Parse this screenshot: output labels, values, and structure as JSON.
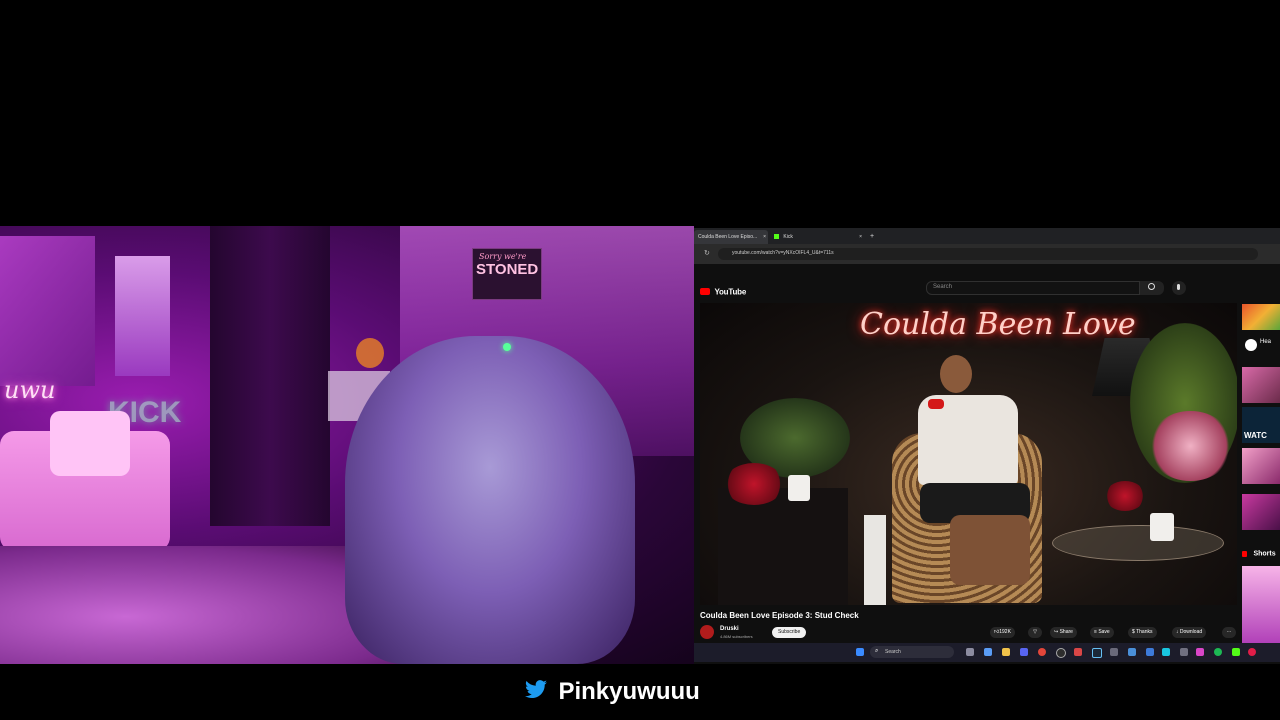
{
  "webcam": {
    "neon_sign_left": "uwu",
    "neon_sign_kick": "KICK",
    "poster_top": "STONED",
    "poster_sub": "Sorry we're",
    "neon_small": "u"
  },
  "browser": {
    "tabs": [
      {
        "label": "Coulda Been Love Episo..."
      },
      {
        "label": "Kick"
      }
    ],
    "new_tab": "+",
    "tab_close": "×",
    "url": "youtube.com/watch?v=yNXcOIFL4_U&t=711s"
  },
  "youtube": {
    "logo": "YouTube",
    "search_placeholder": "Search",
    "video_neon_title": "Coulda Been Love",
    "video_title": "Coulda Been Love Episode 3: Stud Check",
    "channel_name": "Druski",
    "channel_subs": "4.86M subscribers",
    "subscribe": "Subscribe",
    "likes": "192K",
    "share": "Share",
    "save": "Save",
    "thanks": "Thanks",
    "download": "Download",
    "more": "···",
    "sidebar_head": "Hea",
    "sidebar_watch": "WATC",
    "shorts": "Shorts"
  },
  "taskbar": {
    "search": "Search"
  },
  "footer": {
    "handle": "Pinkyuwuuu"
  },
  "colors": {
    "youtube_red": "#ff0000",
    "twitter_blue": "#1d9bf0",
    "neon_pink": "#ff4fd0"
  }
}
